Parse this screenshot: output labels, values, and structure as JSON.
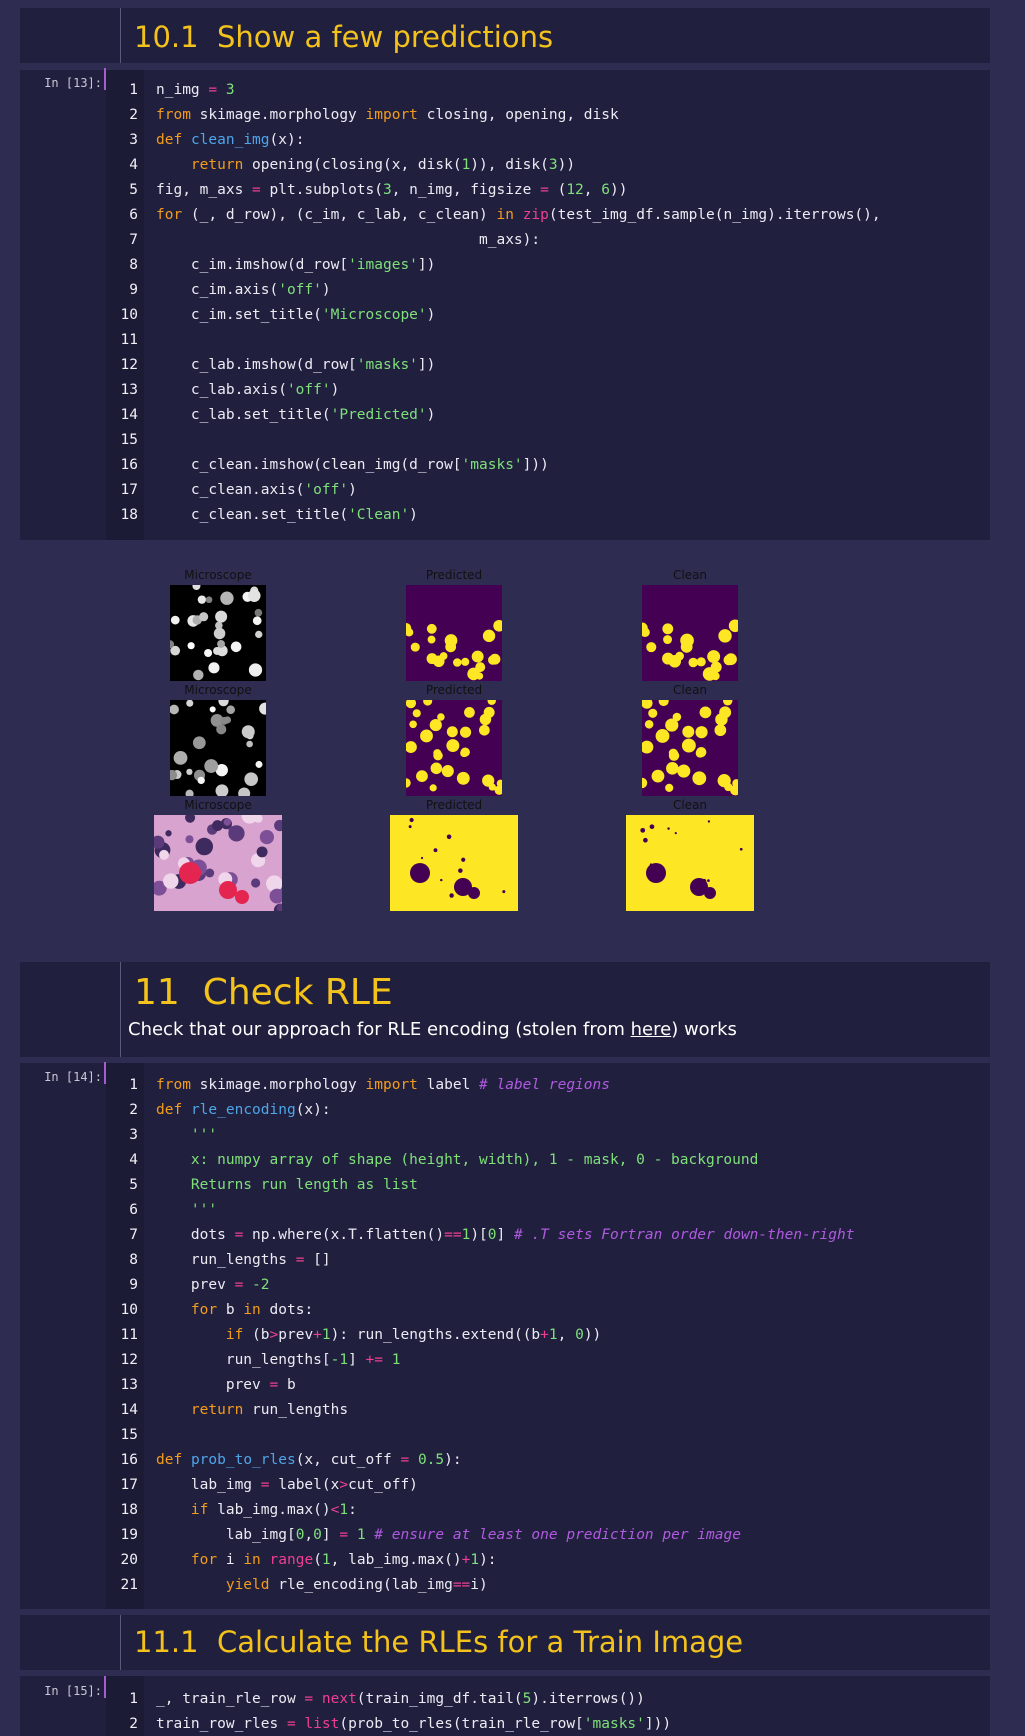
{
  "section_10_1": {
    "heading": "10.1  Show a few predictions"
  },
  "cell_13": {
    "prompt": "In [13]:",
    "lines": [
      "n_img = 3",
      "from skimage.morphology import closing, opening, disk",
      "def clean_img(x):",
      "    return opening(closing(x, disk(1)), disk(3))",
      "fig, m_axs = plt.subplots(3, n_img, figsize = (12, 6))",
      "for (_, d_row), (c_im, c_lab, c_clean) in zip(test_img_df.sample(n_img).iterrows(),",
      "                                     m_axs):",
      "    c_im.imshow(d_row['images'])",
      "    c_im.axis('off')",
      "    c_im.set_title('Microscope')",
      "",
      "    c_lab.imshow(d_row['masks'])",
      "    c_lab.axis('off')",
      "    c_lab.set_title('Predicted')",
      "",
      "    c_clean.imshow(clean_img(d_row['masks']))",
      "    c_clean.axis('off')",
      "    c_clean.set_title('Clean')"
    ]
  },
  "output_13": {
    "titles": [
      "Microscope",
      "Predicted",
      "Clean"
    ],
    "colors": {
      "viridis_purple": "#440154",
      "viridis_yellow": "#fde725"
    }
  },
  "section_11": {
    "heading": "11  Check RLE",
    "text_before": "Check that our approach for RLE encoding (stolen from ",
    "link_text": "here",
    "text_after": ") works"
  },
  "cell_14": {
    "prompt": "In [14]:",
    "lines": [
      "from skimage.morphology import label # label regions",
      "def rle_encoding(x):",
      "    '''",
      "    x: numpy array of shape (height, width), 1 - mask, 0 - background",
      "    Returns run length as list",
      "    '''",
      "    dots = np.where(x.T.flatten()==1)[0] # .T sets Fortran order down-then-right",
      "    run_lengths = []",
      "    prev = -2",
      "    for b in dots:",
      "        if (b>prev+1): run_lengths.extend((b+1, 0))",
      "        run_lengths[-1] += 1",
      "        prev = b",
      "    return run_lengths",
      "",
      "def prob_to_rles(x, cut_off = 0.5):",
      "    lab_img = label(x>cut_off)",
      "    if lab_img.max()<1:",
      "        lab_img[0,0] = 1 # ensure at least one prediction per image",
      "    for i in range(1, lab_img.max()+1):",
      "        yield rle_encoding(lab_img==i)"
    ]
  },
  "section_11_1": {
    "heading": "11.1  Calculate the RLEs for a Train Image"
  },
  "cell_15": {
    "prompt": "In [15]:",
    "lines": [
      "_, train_rle_row = next(train_img_df.tail(5).iterrows())",
      "train_row_rles = list(prob_to_rles(train_rle_row['masks']))"
    ]
  }
}
